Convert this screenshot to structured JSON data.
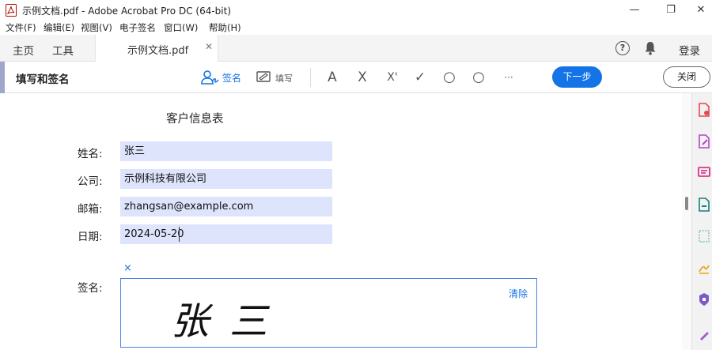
{
  "window": {
    "title": "示例文档.pdf - Adobe Acrobat Pro DC (64-bit)",
    "minimize": "—",
    "restore": "❐",
    "close": "✕"
  },
  "menu": {
    "items": [
      "文件(F)",
      "编辑(E)",
      "视图(V)",
      "电子签名",
      "窗口(W)",
      "帮助(H)"
    ]
  },
  "tabs": {
    "home": "主页",
    "tools": "工具",
    "document": "示例文档.pdf",
    "close_icon": "✕",
    "help": "?",
    "login": "登录"
  },
  "toolbar": {
    "title": "填写和签名",
    "sign_label": "签名",
    "fill_label": "填写",
    "tools": [
      "A",
      "X",
      "X'",
      "✓",
      "○",
      "○",
      "···"
    ],
    "next_label": "下一步",
    "close_label": "关闭"
  },
  "document": {
    "title": "客户信息表",
    "fields": [
      {
        "label": "姓名:",
        "value": "张三"
      },
      {
        "label": "公司:",
        "value": "示例科技有限公司"
      },
      {
        "label": "邮箱:",
        "value": "zhangsan@example.com"
      },
      {
        "label": "日期:",
        "value": "2024-05-20"
      }
    ],
    "signature_label": "签名:",
    "signature_remove": "×",
    "signature_clear": "清除",
    "signature_text": "张三"
  },
  "colors": {
    "accent": "#1473e6",
    "field_bg": "#dde4fb",
    "toolbar_accent": "#9ea7c9"
  }
}
